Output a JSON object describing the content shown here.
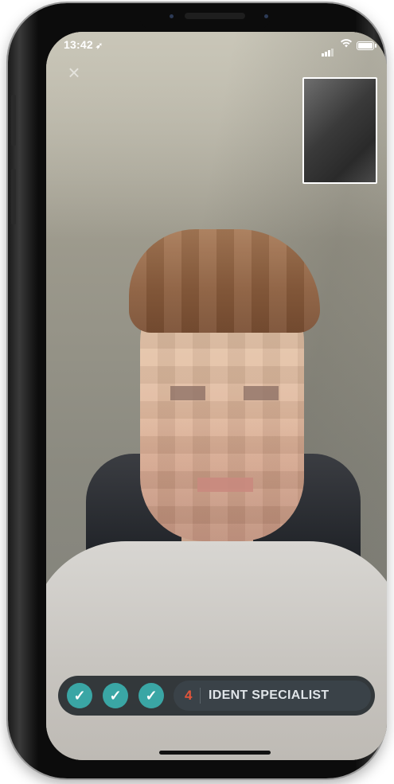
{
  "status_bar": {
    "time": "13:42",
    "location_icon": "location-arrow-icon",
    "signal_icon": "signal-icon",
    "wifi_icon": "wifi-icon",
    "battery_icon": "battery-icon"
  },
  "call": {
    "close_icon": "close-icon",
    "self_preview": "self-camera-preview"
  },
  "progress": {
    "completed_steps": [
      {
        "icon": "checkmark-icon",
        "glyph": "✓"
      },
      {
        "icon": "checkmark-icon",
        "glyph": "✓"
      },
      {
        "icon": "checkmark-icon",
        "glyph": "✓"
      }
    ],
    "current_step_number": "4",
    "current_step_label": "IDENT SPECIALIST"
  },
  "colors": {
    "step_complete": "#3aa6a5",
    "step_number": "#e2543a",
    "pill_bg": "#262c30"
  }
}
